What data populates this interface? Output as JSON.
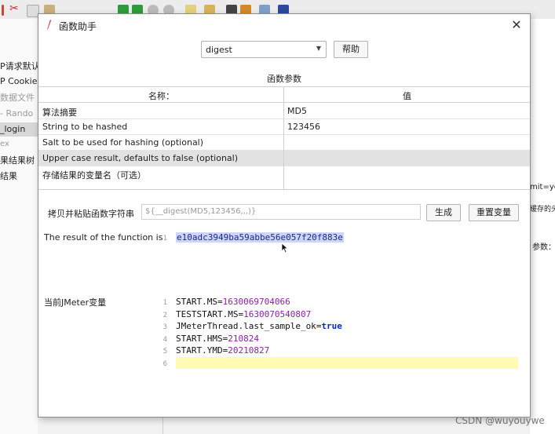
{
  "background": {
    "tree_items": [
      "P请求默认",
      "P Cookie",
      "数据文件",
      "- Rando",
      "_login",
      "ex",
      "果结果树",
      "结果"
    ],
    "right_texts": [
      "mit=ye",
      "缓存的头",
      "参数："
    ]
  },
  "watermark": "CSDN @wuyouywe",
  "dialog": {
    "title": "函数助手",
    "function_select": "digest",
    "help_label": "帮助",
    "params_title": "函数参数",
    "headers": {
      "name": "名称：",
      "value": "值"
    },
    "params": [
      {
        "name": "算法摘要",
        "value": "MD5"
      },
      {
        "name": "String to be hashed",
        "value": "123456"
      },
      {
        "name": "Salt to be used for hashing (optional)",
        "value": ""
      },
      {
        "name": "Upper case result, defaults to false (optional)",
        "value": ""
      },
      {
        "name": "存储结果的变量名（可选）",
        "value": ""
      }
    ],
    "copy_label": "拷贝并粘贴函数字符串",
    "function_string": "${__digest(MD5,123456,,,)}",
    "generate_label": "生成",
    "reset_label": "重置变量",
    "result_label": "The result of the function is",
    "result_line_no": "1",
    "result": "e10adc3949ba59abbe56e057f20f883e",
    "vars_label": "当前JMeter变量",
    "variables": [
      {
        "n": "1",
        "key": "START.MS",
        "value": "1630069704066",
        "kind": "num"
      },
      {
        "n": "2",
        "key": "TESTSTART.MS",
        "value": "1630070540807",
        "kind": "num"
      },
      {
        "n": "3",
        "key": "JMeterThread.last_sample_ok",
        "value": "true",
        "kind": "kw"
      },
      {
        "n": "4",
        "key": "START.HMS",
        "value": "210824",
        "kind": "num"
      },
      {
        "n": "5",
        "key": "START.YMD",
        "value": "20210827",
        "kind": "num"
      },
      {
        "n": "6",
        "key": "",
        "value": "",
        "kind": ""
      }
    ]
  }
}
